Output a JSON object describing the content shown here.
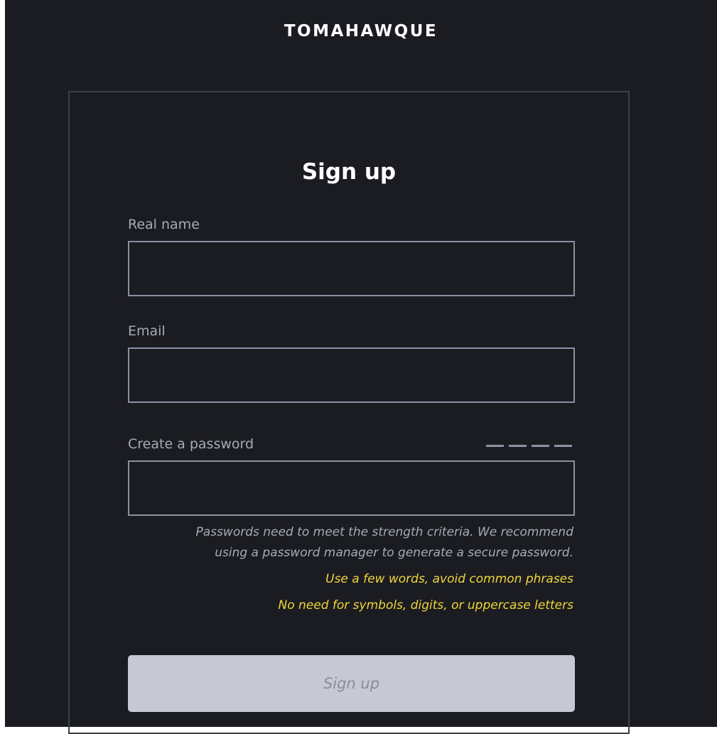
{
  "header": {
    "brand": "TOMAHAWQUE"
  },
  "form": {
    "title": "Sign up",
    "fields": {
      "real_name": {
        "label": "Real name",
        "value": "",
        "placeholder": ""
      },
      "email": {
        "label": "Email",
        "value": "",
        "placeholder": ""
      },
      "password": {
        "label": "Create a password",
        "value": "",
        "placeholder": ""
      }
    },
    "password_strength": {
      "segments_filled": 0,
      "segments_total": 4
    },
    "hints": {
      "line1": "Passwords need to meet the strength criteria. We recommend",
      "line2": "using a password manager to generate a secure password.",
      "tip1": "Use a few words, avoid common phrases",
      "tip2": "No need for symbols, digits, or uppercase letters"
    },
    "submit_label": "Sign up"
  },
  "colors": {
    "background": "#1b1c21",
    "text": "#ffffff",
    "label": "#a6aab9",
    "field_border": "#8a8fa3",
    "tip": "#f1d63a",
    "button_disabled_bg": "#c6c9d3",
    "button_disabled_text": "#8b8e99"
  }
}
